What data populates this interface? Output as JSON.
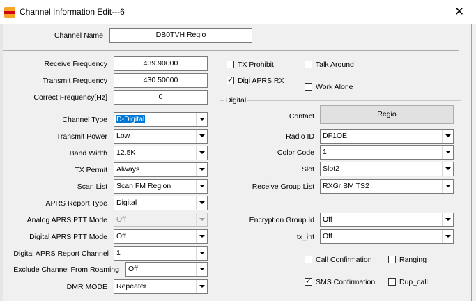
{
  "window": {
    "title": "Channel Information Edit---6",
    "close_glyph": "✕"
  },
  "channel_name": {
    "label": "Channel Name",
    "value": "DB0TVH Regio"
  },
  "left": {
    "receive_frequency": {
      "label": "Receive Frequency",
      "value": "439.90000"
    },
    "transmit_frequency": {
      "label": "Transmit Frequency",
      "value": "430.50000"
    },
    "correct_frequency": {
      "label": "Correct Frequency[Hz]",
      "value": "0"
    },
    "channel_type": {
      "label": "Channel Type",
      "value": "D-Digital"
    },
    "transmit_power": {
      "label": "Transmit Power",
      "value": "Low"
    },
    "band_width": {
      "label": "Band Width",
      "value": "12.5K"
    },
    "tx_permit": {
      "label": "TX Permit",
      "value": "Always"
    },
    "scan_list": {
      "label": "Scan List",
      "value": "Scan FM Region"
    },
    "aprs_report_type": {
      "label": "APRS Report Type",
      "value": "Digital"
    },
    "analog_aprs_ptt_mode": {
      "label": "Analog APRS PTT Mode",
      "value": "Off"
    },
    "digital_aprs_ptt_mode": {
      "label": "Digital APRS PTT Mode",
      "value": "Off"
    },
    "digital_aprs_report_channel": {
      "label": "Digital APRS Report Channel",
      "value": "1"
    },
    "exclude_channel_from_roaming": {
      "label": "Exclude Channel From Roaming",
      "value": "Off"
    },
    "dmr_mode": {
      "label": "DMR MODE",
      "value": "Repeater"
    }
  },
  "options": {
    "tx_prohibit": {
      "label": "TX Prohibit",
      "checked": false
    },
    "talk_around": {
      "label": "Talk Around",
      "checked": false
    },
    "digi_aprs_rx": {
      "label": "Digi APRS RX",
      "checked": true
    },
    "work_alone": {
      "label": "Work Alone",
      "checked": false
    }
  },
  "digital": {
    "group_title": "Digital",
    "contact": {
      "label": "Contact",
      "value": "Regio"
    },
    "radio_id": {
      "label": "Radio ID",
      "value": "DF1OE"
    },
    "color_code": {
      "label": "Color Code",
      "value": "1"
    },
    "slot": {
      "label": "Slot",
      "value": "Slot2"
    },
    "receive_group_list": {
      "label": "Receive Group List",
      "value": "RXGr BM TS2"
    },
    "encryption_group_id": {
      "label": "Encryption Group Id",
      "value": "Off"
    },
    "tx_int": {
      "label": "tx_int",
      "value": "Off"
    },
    "call_confirmation": {
      "label": "Call Confirmation",
      "checked": false
    },
    "ranging": {
      "label": "Ranging",
      "checked": false
    },
    "sms_confirmation": {
      "label": "SMS Confirmation",
      "checked": true
    },
    "dup_call": {
      "label": "Dup_call",
      "checked": false
    }
  },
  "colors": {
    "selection": "#0078d7",
    "dialog_bg": "#f0f0f0",
    "app_icon": "#f5a623"
  }
}
